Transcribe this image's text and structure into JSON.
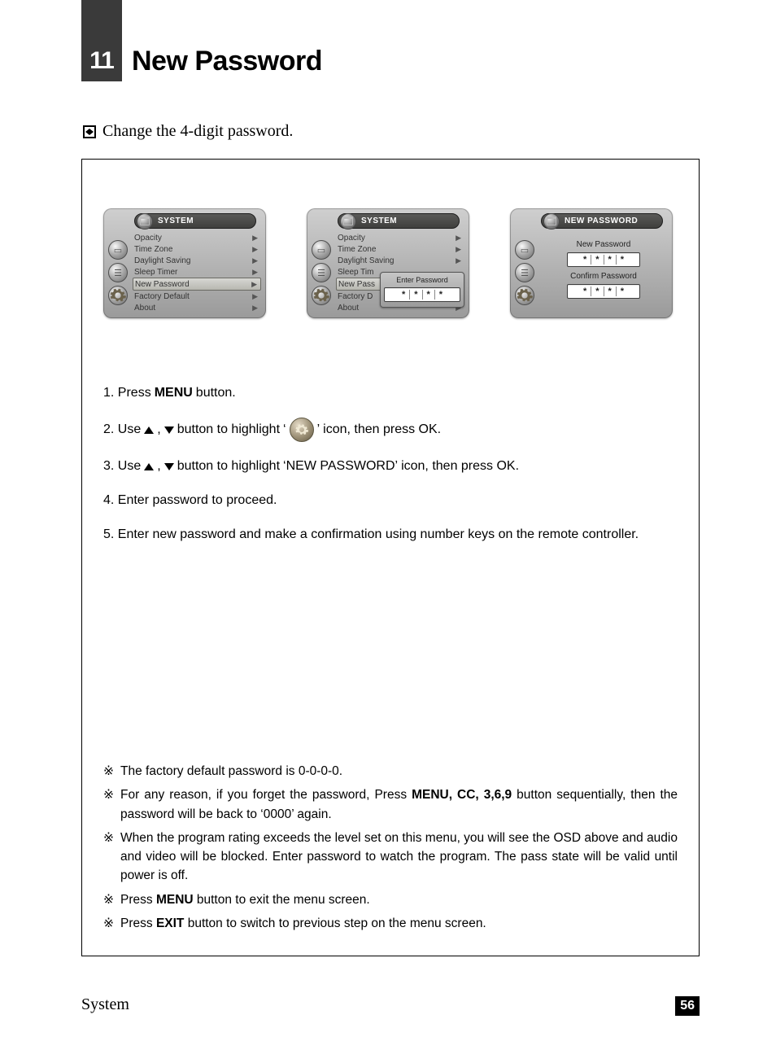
{
  "header": {
    "badge": "11",
    "title": "New Password"
  },
  "intro": "Change the 4-digit password.",
  "panels": {
    "system_title": "SYSTEM",
    "menu1_items": [
      {
        "label": "Opacity",
        "selected": false
      },
      {
        "label": "Time Zone",
        "selected": false
      },
      {
        "label": "Daylight Saving",
        "selected": false
      },
      {
        "label": "Sleep Timer",
        "selected": false
      },
      {
        "label": "New Password",
        "selected": true
      },
      {
        "label": "Factory Default",
        "selected": false
      },
      {
        "label": "About",
        "selected": false
      }
    ],
    "menu2_items_visible": [
      "Opacity",
      "Time Zone",
      "Daylight Saving",
      "Sleep Tim",
      "New Pass",
      "Factory D",
      "About"
    ],
    "popup_title": "Enter Password",
    "popup_mask": [
      "*",
      "*",
      "*",
      "*"
    ],
    "panel3_title": "NEW PASSWORD",
    "panel3_label1": "New Password",
    "panel3_mask1": [
      "*",
      "*",
      "*",
      "*"
    ],
    "panel3_label2": "Confirm Password",
    "panel3_mask2": [
      "*",
      "*",
      "*",
      "*"
    ]
  },
  "steps": {
    "s1a": "1. Press ",
    "s1b": "MENU",
    "s1c": " button.",
    "s2a": "2. Use ",
    "s2b": " button to highlight ",
    "s2c": " icon, then press OK.",
    "s2_apostL": "‘",
    "s2_apostR": "’",
    "s3a": "3. Use ",
    "s3b": " button to highlight ",
    "s3c": "‘NEW PASSWORD’",
    "s3d": " icon, then press OK.",
    "s4": "4. Enter password to proceed.",
    "s5": "5. Enter new password and make a confirmation using number keys on the remote controller."
  },
  "notes": {
    "mark": "※",
    "n1": "The factory default password is 0-0-0-0.",
    "n2a": "For any reason, if you forget the password, Press ",
    "n2b": "MENU, CC, 3,6,9",
    "n2c": " button sequentially, then the password will be back to ‘0000’ again.",
    "n3": "When the program rating exceeds the level set on this menu, you will see  the OSD above and audio and video will be blocked. Enter password to watch the program. The pass state will be valid until power is off.",
    "n4a": "Press ",
    "n4b": "MENU",
    "n4c": " button to exit the menu screen.",
    "n5a": "Press ",
    "n5b": "EXIT",
    "n5c": " button to switch to previous step on the menu screen."
  },
  "footer": {
    "section": "System",
    "page": "56"
  }
}
